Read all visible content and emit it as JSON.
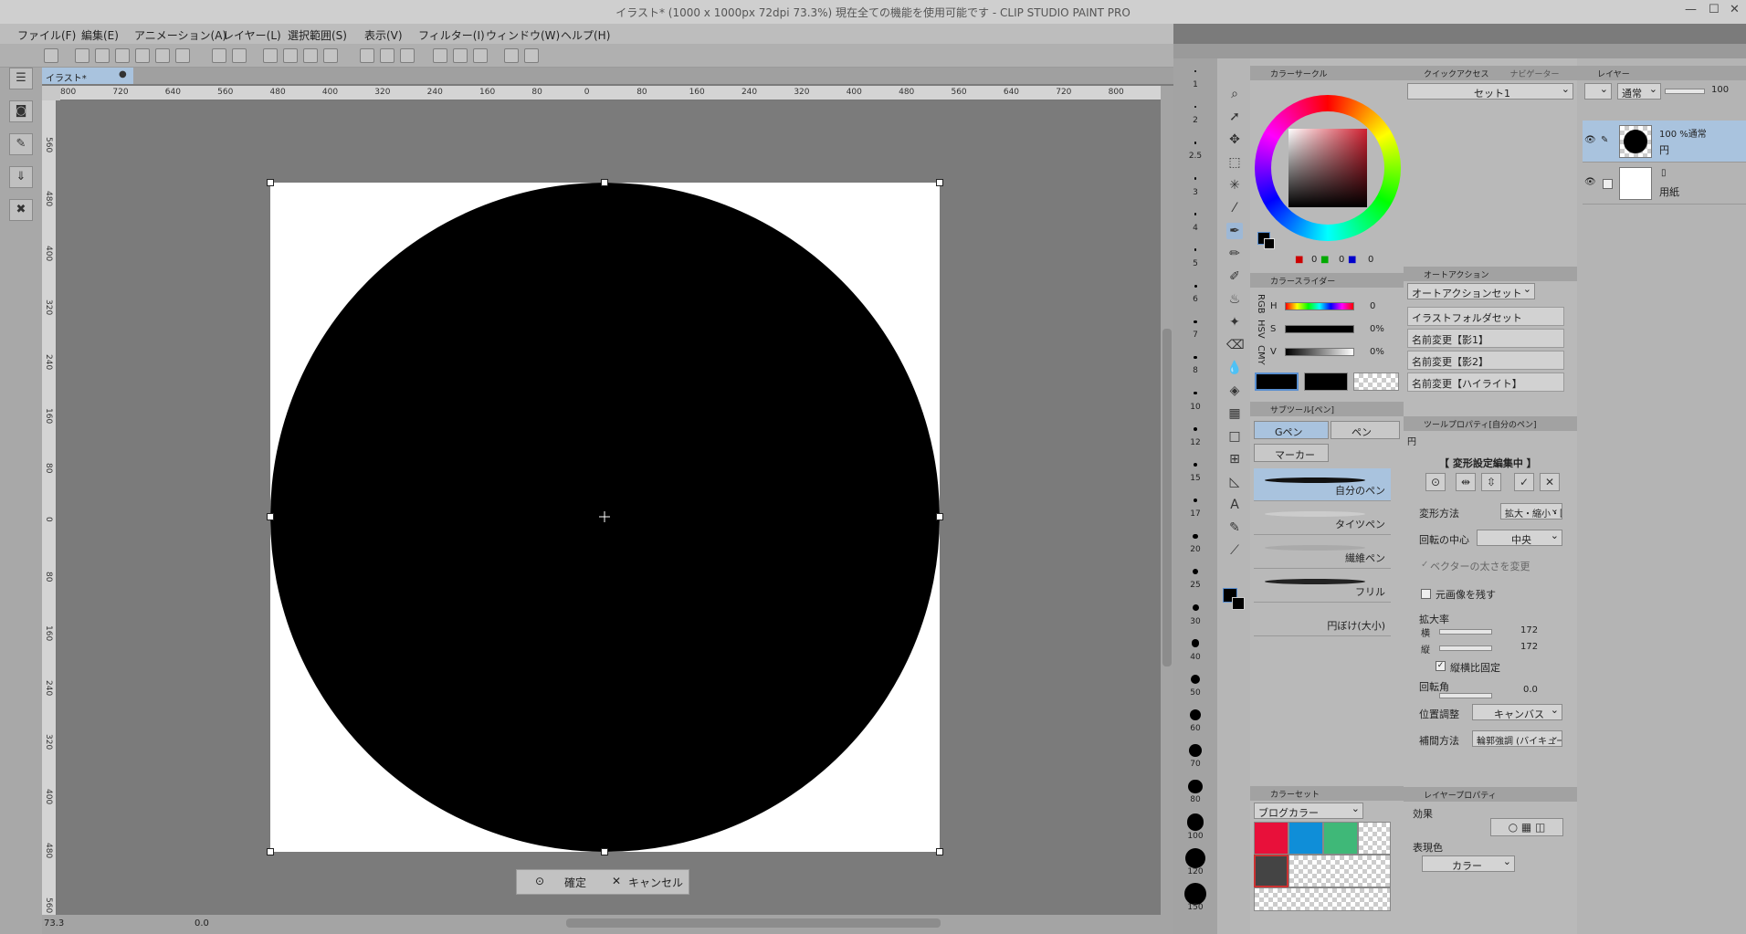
{
  "window": {
    "title": "イラスト* (1000 x 1000px 72dpi 73.3%)  現在全ての機能を使用可能です - CLIP STUDIO PAINT PRO",
    "min": "—",
    "max": "☐",
    "close": "✕"
  },
  "menu": [
    "ファイル(F)",
    "編集(E)",
    "アニメーション(A)",
    "レイヤー(L)",
    "選択範囲(S)",
    "表示(V)",
    "フィルター(I)",
    "ウィンドウ(W)",
    "ヘルプ(H)"
  ],
  "doc_tab": {
    "label": "イラスト*",
    "close": "●"
  },
  "ruler_h": [
    "800",
    "720",
    "640",
    "560",
    "480",
    "400",
    "320",
    "240",
    "160",
    "80",
    "0",
    "80",
    "160",
    "240",
    "320",
    "400",
    "480",
    "560",
    "640",
    "720",
    "800"
  ],
  "ruler_v": [
    "560",
    "480",
    "400",
    "320",
    "240",
    "160",
    "80",
    "0",
    "80",
    "160",
    "240",
    "320",
    "400",
    "480",
    "560"
  ],
  "transform_bar": {
    "confirm": "確定",
    "cancel": "キャンセル"
  },
  "status": {
    "zoom": "73.3",
    "angle": "0.0"
  },
  "brush_sizes": [
    "1",
    "2",
    "2.5",
    "3",
    "4",
    "5",
    "6",
    "7",
    "8",
    "10",
    "12",
    "15",
    "17",
    "20",
    "25",
    "30",
    "40",
    "50",
    "60",
    "70",
    "80",
    "100",
    "120",
    "150"
  ],
  "color_circle": {
    "title": "カラーサークル",
    "r": "0",
    "g": "0",
    "b": "0"
  },
  "color_slider": {
    "title": "カラースライダー",
    "h": "H",
    "s": "S",
    "v": "V",
    "h_val": "0",
    "s_val": "0%",
    "v_val": "0%",
    "tabs": [
      "RGB",
      "HSV",
      "CMY"
    ]
  },
  "subtool": {
    "title": "サブツール[ペン]",
    "tabs": [
      "Gペン",
      "ペン",
      "マーカー"
    ],
    "brushes": [
      "自分のペン",
      "タイツペン",
      "繊維ペン",
      "フリル",
      "円ぼけ(大小)"
    ]
  },
  "colorset": {
    "title": "カラーセット",
    "set_name": "ブログカラー",
    "colors": [
      "#e8103a",
      "#0f8ed8",
      "#3fb878",
      "",
      "#444444"
    ]
  },
  "quick_access": {
    "title": "クイックアクセス",
    "tab2": "ナビゲーター",
    "set": "セット1"
  },
  "auto_action": {
    "title": "オートアクション",
    "set": "オートアクションセット",
    "items": [
      "イラストフォルダセット",
      "名前変更【影1】",
      "名前変更【影2】",
      "名前変更【ハイライト】"
    ]
  },
  "tool_property": {
    "title": "ツールプロパティ[自分のペン]",
    "object": "円",
    "editing": "【 変形設定編集中 】",
    "method_label": "変形方法",
    "method_val": "拡大・縮小・回転",
    "center_label": "回転の中心",
    "center_val": "中央",
    "vector_label": "ベクターの太さを変更",
    "keep_label": "元画像を残す",
    "scale_label": "拡大率",
    "w_label": "横",
    "w_val": "172",
    "h_label": "縦",
    "h_val": "172",
    "lock_label": "縦横比固定",
    "rot_label": "回転角",
    "rot_val": "0.0",
    "pos_label": "位置調整",
    "pos_val": "キャンバス",
    "interp_label": "補間方法",
    "interp_val": "輪郭強調 (バイキュービック法)"
  },
  "layer_property": {
    "title": "レイヤープロパティ",
    "effect": "効果",
    "expr_label": "表現色",
    "expr_val": "カラー"
  },
  "layer": {
    "title": "レイヤー",
    "blend": "通常",
    "opacity": "100",
    "layers": [
      {
        "meta": "100 %通常",
        "name": "円"
      },
      {
        "meta": "",
        "name": "用紙"
      }
    ]
  }
}
